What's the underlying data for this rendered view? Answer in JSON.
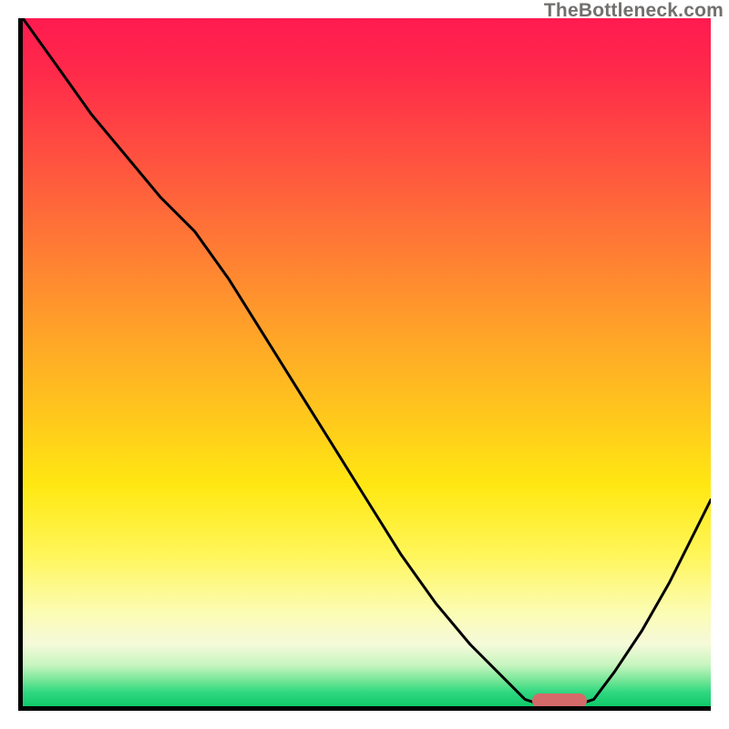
{
  "watermark": "TheBottleneck.com",
  "chart_data": {
    "type": "line",
    "title": "",
    "xlabel": "",
    "ylabel": "",
    "xlim": [
      0,
      100
    ],
    "ylim": [
      0,
      100
    ],
    "grid": false,
    "series": [
      {
        "name": "curve",
        "x": [
          0,
          5,
          10,
          15,
          20,
          25,
          30,
          35,
          40,
          45,
          50,
          55,
          60,
          65,
          70,
          73,
          76,
          80,
          83,
          86,
          90,
          94,
          97,
          100
        ],
        "y": [
          100,
          93,
          86,
          80,
          74,
          69,
          62,
          54,
          46,
          38,
          30,
          22,
          15,
          9,
          4,
          1,
          0,
          0,
          1,
          5,
          11,
          18,
          24,
          30
        ]
      }
    ],
    "marker": {
      "x": 78,
      "y": 0,
      "color": "#d46a6a"
    },
    "background_gradient": {
      "top": "#ff1a50",
      "mid": "#ffd020",
      "bottom": "#10c96a"
    }
  }
}
